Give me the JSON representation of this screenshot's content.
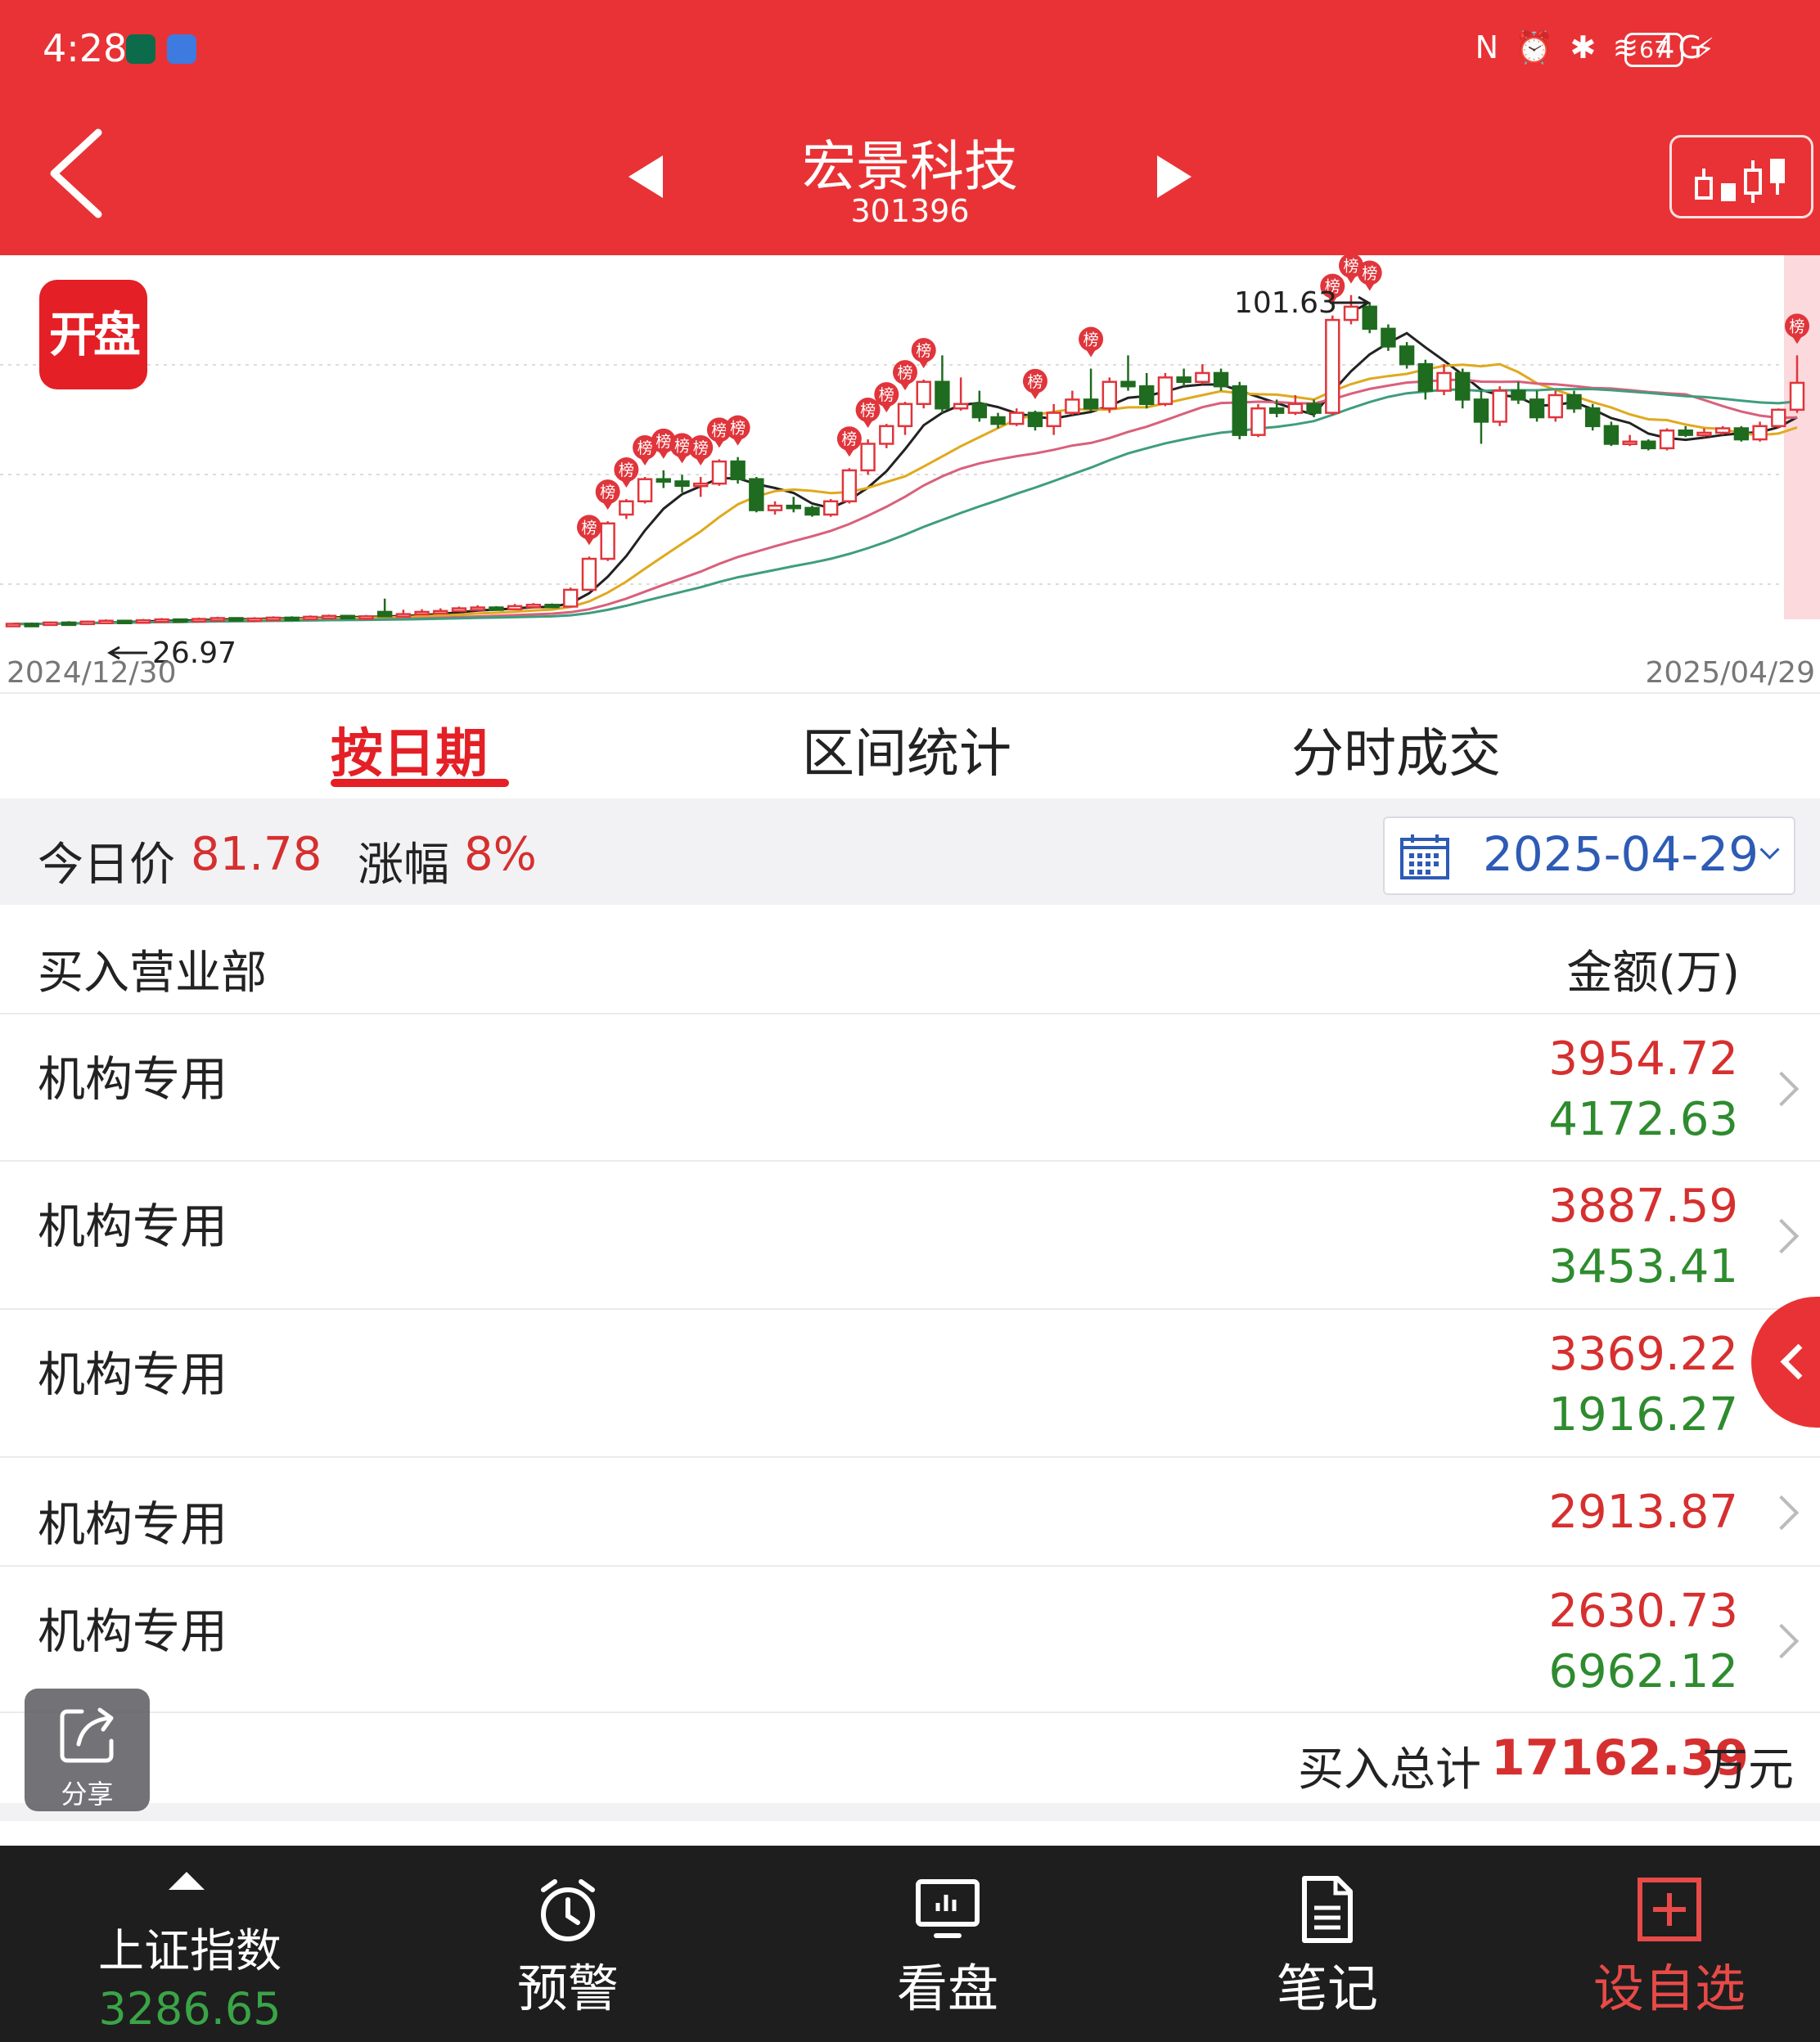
{
  "status_bar": {
    "time": "4:28",
    "right_icons": "N ⏰ ✱ ≋ 4G",
    "battery": "67"
  },
  "header": {
    "stock_name": "宏景科技",
    "stock_code": "301396",
    "bg_color": "#e93235"
  },
  "chart_data": {
    "type": "candlestick",
    "x_start": "2024/12/30",
    "x_end": "2025/04/29",
    "high_label": "101.63",
    "low_label": "26.97",
    "marker_label": "榜",
    "badge_label": "开盘",
    "up_color": "#e0353b",
    "down_color": "#1f6b1f",
    "candles": [
      [
        27.0,
        27.3,
        26.97,
        27.5
      ],
      [
        27.3,
        27.2,
        27.0,
        27.6
      ],
      [
        27.2,
        27.6,
        27.1,
        27.8
      ],
      [
        27.6,
        27.4,
        27.2,
        27.9
      ],
      [
        27.4,
        27.8,
        27.3,
        28.0
      ],
      [
        27.8,
        28.0,
        27.6,
        28.3
      ],
      [
        28.0,
        27.7,
        27.5,
        28.2
      ],
      [
        27.7,
        28.1,
        27.6,
        28.4
      ],
      [
        28.1,
        28.3,
        27.9,
        28.6
      ],
      [
        28.3,
        28.0,
        27.8,
        28.5
      ],
      [
        28.0,
        28.4,
        27.9,
        28.7
      ],
      [
        28.4,
        28.6,
        28.2,
        28.9
      ],
      [
        28.6,
        28.3,
        28.1,
        28.8
      ],
      [
        28.3,
        28.5,
        28.2,
        28.8
      ],
      [
        28.5,
        28.7,
        28.3,
        29.0
      ],
      [
        28.7,
        28.5,
        28.3,
        29.0
      ],
      [
        28.5,
        28.9,
        28.4,
        29.2
      ],
      [
        28.9,
        29.1,
        28.7,
        29.4
      ],
      [
        29.1,
        28.8,
        28.6,
        29.3
      ],
      [
        28.8,
        29.0,
        28.7,
        29.3
      ],
      [
        30.0,
        29.0,
        28.8,
        33.0
      ],
      [
        29.0,
        29.5,
        28.9,
        30.5
      ],
      [
        29.5,
        30.0,
        29.3,
        30.6
      ],
      [
        30.0,
        30.2,
        29.8,
        30.8
      ],
      [
        30.2,
        30.8,
        30.0,
        31.2
      ],
      [
        30.8,
        31.0,
        30.5,
        31.5
      ],
      [
        31.0,
        30.6,
        30.3,
        31.3
      ],
      [
        30.6,
        31.3,
        30.4,
        31.8
      ],
      [
        31.3,
        31.6,
        31.0,
        32.0
      ],
      [
        31.6,
        31.2,
        30.9,
        31.9
      ],
      [
        31.2,
        35.0,
        31.0,
        35.5
      ],
      [
        35.0,
        42.0,
        34.8,
        42.5
      ],
      [
        42.0,
        50.0,
        41.5,
        50.5
      ],
      [
        52.0,
        55.0,
        51.0,
        55.5
      ],
      [
        55.0,
        60.0,
        54.5,
        60.5
      ],
      [
        60.0,
        59.5,
        58.0,
        62.0
      ],
      [
        59.5,
        58.5,
        57.0,
        61.0
      ],
      [
        58.5,
        59.0,
        56.0,
        60.5
      ],
      [
        59.0,
        64.0,
        58.5,
        64.5
      ],
      [
        64.0,
        60.0,
        59.0,
        65.0
      ],
      [
        60.0,
        53.0,
        52.5,
        60.5
      ],
      [
        53.0,
        54.0,
        52.0,
        55.0
      ],
      [
        54.0,
        53.5,
        52.5,
        56.0
      ],
      [
        53.5,
        52.0,
        51.5,
        54.0
      ],
      [
        52.0,
        55.0,
        51.5,
        55.5
      ],
      [
        55.0,
        62.0,
        54.5,
        62.5
      ],
      [
        62.0,
        68.0,
        61.0,
        69.0
      ],
      [
        68.0,
        72.0,
        67.0,
        72.5
      ],
      [
        72.0,
        77.0,
        70.0,
        77.5
      ],
      [
        77.0,
        82.0,
        76.0,
        82.5
      ],
      [
        82.0,
        76.0,
        75.0,
        88.0
      ],
      [
        76.0,
        77.0,
        75.5,
        83.0
      ],
      [
        77.0,
        74.0,
        73.0,
        80.0
      ],
      [
        74.0,
        72.5,
        71.5,
        75.0
      ],
      [
        72.5,
        75.0,
        72.0,
        76.0
      ],
      [
        75.0,
        72.0,
        71.0,
        75.5
      ],
      [
        72.0,
        75.0,
        70.0,
        77.0
      ],
      [
        75.0,
        78.0,
        74.5,
        80.0
      ],
      [
        78.0,
        76.0,
        75.5,
        85.0
      ],
      [
        76.0,
        82.0,
        75.0,
        83.0
      ],
      [
        82.0,
        81.0,
        80.0,
        88.0
      ],
      [
        81.0,
        77.0,
        76.0,
        84.0
      ],
      [
        77.0,
        83.0,
        76.5,
        84.0
      ],
      [
        83.0,
        82.0,
        81.0,
        85.0
      ],
      [
        82.0,
        84.0,
        81.5,
        86.0
      ],
      [
        84.0,
        81.0,
        80.0,
        85.0
      ],
      [
        81.0,
        70.0,
        69.0,
        82.0
      ],
      [
        70.0,
        76.0,
        69.5,
        77.0
      ],
      [
        76.0,
        75.0,
        74.0,
        78.0
      ],
      [
        75.0,
        77.0,
        74.5,
        79.0
      ],
      [
        77.0,
        75.0,
        74.0,
        78.0
      ],
      [
        75.0,
        96.0,
        74.5,
        97.0
      ],
      [
        96.0,
        99.0,
        95.0,
        101.63
      ],
      [
        99.0,
        94.0,
        93.0,
        100.0
      ],
      [
        94.0,
        90.0,
        89.0,
        95.0
      ],
      [
        90.0,
        86.0,
        85.0,
        91.0
      ],
      [
        86.0,
        80.0,
        78.0,
        87.0
      ],
      [
        80.0,
        84.0,
        79.0,
        86.0
      ],
      [
        84.0,
        78.0,
        76.0,
        85.0
      ],
      [
        78.0,
        73.0,
        68.0,
        80.0
      ],
      [
        73.0,
        80.0,
        72.0,
        81.0
      ],
      [
        80.0,
        78.0,
        77.0,
        82.0
      ],
      [
        78.0,
        74.0,
        73.0,
        80.0
      ],
      [
        74.0,
        79.0,
        73.0,
        80.0
      ],
      [
        79.0,
        76.0,
        75.0,
        80.0
      ],
      [
        76.0,
        72.0,
        71.0,
        77.0
      ],
      [
        72.0,
        68.0,
        67.5,
        73.0
      ],
      [
        68.0,
        68.5,
        67.5,
        70.0
      ],
      [
        68.5,
        67.0,
        66.5,
        69.0
      ],
      [
        67.0,
        71.0,
        66.5,
        71.5
      ],
      [
        71.0,
        70.0,
        69.5,
        72.0
      ],
      [
        70.0,
        70.5,
        69.5,
        71.5
      ],
      [
        70.5,
        71.5,
        70.0,
        72.0
      ],
      [
        71.5,
        69.0,
        68.5,
        72.0
      ],
      [
        69.0,
        72.0,
        68.5,
        73.0
      ],
      [
        72.0,
        75.7,
        71.5,
        76.0
      ],
      [
        75.7,
        81.78,
        75.0,
        88.0
      ]
    ]
  },
  "tabs": [
    {
      "label": "按日期",
      "active": true
    },
    {
      "label": "区间统计",
      "active": false
    },
    {
      "label": "分时成交",
      "active": false
    }
  ],
  "price_row": {
    "price_label": "今日价",
    "price_value": "81.78",
    "change_label": "涨幅",
    "change_value": "8%",
    "date": "2025-04-29"
  },
  "list": {
    "header_left": "买入营业部",
    "header_right": "金额(万)",
    "rows": [
      {
        "name": "机构专用",
        "v1": "3954.72",
        "v2": "4172.63"
      },
      {
        "name": "机构专用",
        "v1": "3887.59",
        "v2": "3453.41"
      },
      {
        "name": "机构专用",
        "v1": "3369.22",
        "v2": "1916.27"
      },
      {
        "name": "机构专用",
        "v1": "2913.87",
        "v2": ""
      },
      {
        "name": "机构专用",
        "v1": "2630.73",
        "v2": "6962.12"
      }
    ],
    "total_label": "买入总计",
    "total_value": "17162.39",
    "total_unit": "万元"
  },
  "share": {
    "label": "分享"
  },
  "bottom_nav": {
    "index_label": "上证指数",
    "index_value": "3286.65",
    "items": [
      {
        "label": "预警",
        "icon": "alarm-clock-icon"
      },
      {
        "label": "看盘",
        "icon": "monitor-chart-icon"
      },
      {
        "label": "笔记",
        "icon": "document-icon"
      },
      {
        "label": "设自选",
        "icon": "plus-box-icon"
      }
    ],
    "active_color": "#e84a47"
  }
}
